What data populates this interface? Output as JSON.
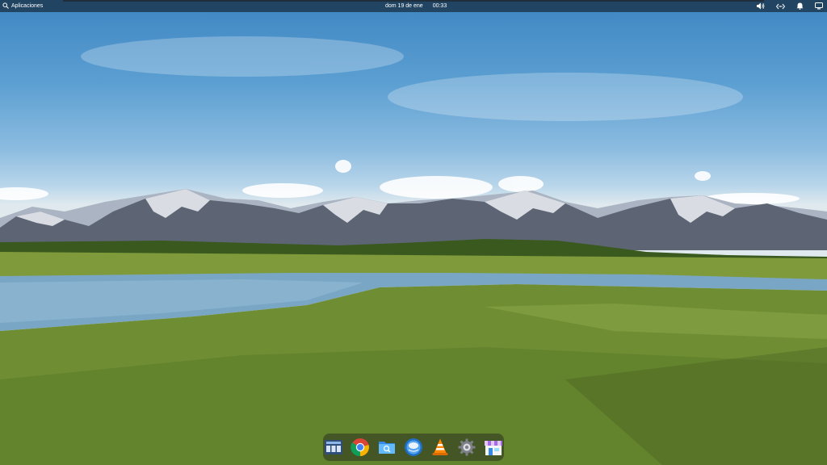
{
  "top_panel": {
    "applications_label": "Aplicaciones",
    "date": "dom 19 de ene",
    "time": "00:33"
  },
  "indicators": [
    {
      "name": "volume-icon"
    },
    {
      "name": "network-icon"
    },
    {
      "name": "notifications-icon"
    },
    {
      "name": "session-icon"
    }
  ],
  "dock": {
    "apps": [
      {
        "name": "multitasking-view-icon"
      },
      {
        "name": "chrome-icon"
      },
      {
        "name": "files-icon"
      },
      {
        "name": "web-browser-icon"
      },
      {
        "name": "vlc-icon"
      },
      {
        "name": "system-settings-icon"
      },
      {
        "name": "app-center-icon"
      }
    ]
  },
  "colors": {
    "sky_top": "#3e86c2",
    "grass": "#6f8e34",
    "water": "#7aa6c5",
    "mountain": "#5d6575"
  }
}
